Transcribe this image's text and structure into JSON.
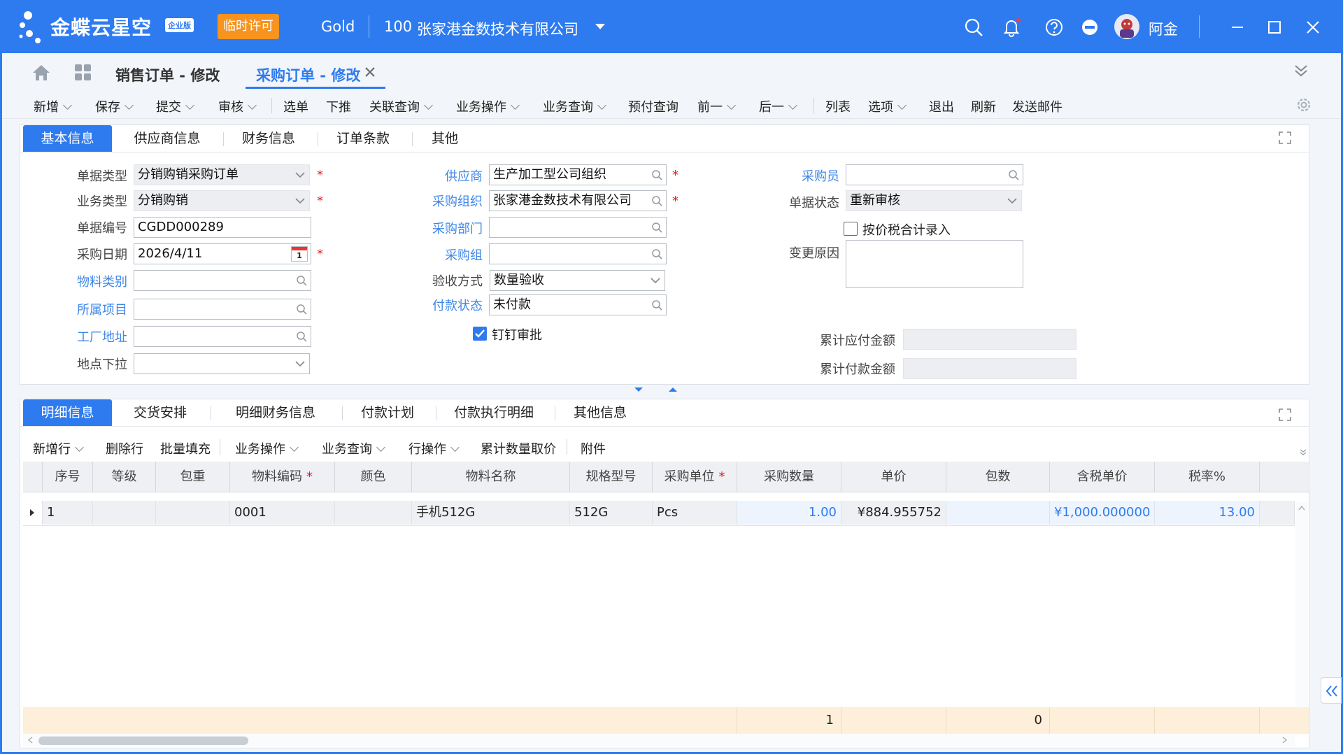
{
  "titlebar": {
    "logo_text": "金蝶云星空",
    "logo_badge": "企业版",
    "license_badge": "临时许可",
    "tenant": "Gold",
    "org_code": "100",
    "org_name": "张家港金数技术有限公司",
    "user_name": "阿金",
    "icons": [
      "search-icon",
      "bell-icon",
      "help-icon",
      "minus-circle-icon",
      "minimize-icon",
      "maximize-icon",
      "close-icon"
    ]
  },
  "doc_tabs": [
    {
      "label": "销售订单 - 修改",
      "active": false
    },
    {
      "label": "采购订单 - 修改",
      "active": true
    }
  ],
  "toolbar": {
    "items": [
      "新增",
      "保存",
      "提交",
      "审核",
      "选单",
      "下推",
      "关联查询",
      "业务操作",
      "业务查询",
      "预付查询",
      "前一",
      "后一",
      "列表",
      "选项",
      "退出",
      "刷新",
      "发送邮件"
    ]
  },
  "header_tabs": [
    "基本信息",
    "供应商信息",
    "财务信息",
    "订单条款",
    "其他"
  ],
  "form": {
    "col1": {
      "doc_type_label": "单据类型",
      "doc_type_value": "分销购销采购订单",
      "biz_type_label": "业务类型",
      "biz_type_value": "分销购销",
      "doc_no_label": "单据编号",
      "doc_no_value": "CGDD000289",
      "date_label": "采购日期",
      "date_value": "2026/4/11",
      "calendar_day": "1",
      "material_cat_label": "物料类别",
      "material_cat_value": "",
      "project_label": "所属项目",
      "project_value": "",
      "factory_label": "工厂地址",
      "factory_value": "",
      "location_label": "地点下拉",
      "location_value": ""
    },
    "col2": {
      "supplier_label": "供应商",
      "supplier_value": "生产加工型公司组织",
      "purchase_org_label": "采购组织",
      "purchase_org_value": "张家港金数技术有限公司",
      "purchase_dept_label": "采购部门",
      "purchase_dept_value": "",
      "purchase_group_label": "采购组",
      "purchase_group_value": "",
      "accept_label": "验收方式",
      "accept_value": "数量验收",
      "pay_status_label": "付款状态",
      "pay_status_value": "未付款",
      "dingtalk_label": "钉钉审批",
      "dingtalk_checked": true
    },
    "col3": {
      "buyer_label": "采购员",
      "buyer_value": "",
      "status_label": "单据状态",
      "status_value": "重新审核",
      "tax_entry_label": "按价税合计录入",
      "tax_entry_checked": false,
      "change_reason_label": "变更原因",
      "change_reason_value": "",
      "acc_payable_label": "累计应付金额",
      "acc_payable_value": "",
      "acc_paid_label": "累计付款金额",
      "acc_paid_value": ""
    }
  },
  "detail_tabs": [
    "明细信息",
    "交货安排",
    "明细财务信息",
    "付款计划",
    "付款执行明细",
    "其他信息"
  ],
  "detail_toolbar": [
    "新增行",
    "删除行",
    "批量填充",
    "业务操作",
    "业务查询",
    "行操作",
    "累计数量取价",
    "附件"
  ],
  "grid": {
    "columns": [
      "序号",
      "等级",
      "包重",
      "物料编码",
      "颜色",
      "物料名称",
      "规格型号",
      "采购单位",
      "采购数量",
      "单价",
      "包数",
      "含税单价",
      "税率%"
    ],
    "required_columns": [
      "物料编码",
      "采购单位"
    ],
    "rows": [
      [
        "1",
        "",
        "",
        "0001",
        "",
        "手机512G",
        "512G",
        "Pcs",
        "1.00",
        "¥884.955752",
        "",
        "¥1,000.000000",
        "13.00"
      ]
    ],
    "summary": {
      "qty_total": "1",
      "pkg_total": "0"
    }
  },
  "colors": {
    "brand": "#2e7bf0",
    "license": "#f7931e",
    "summary_bg": "#fdefd9",
    "required": "#e02020",
    "link": "#3f87e8"
  }
}
